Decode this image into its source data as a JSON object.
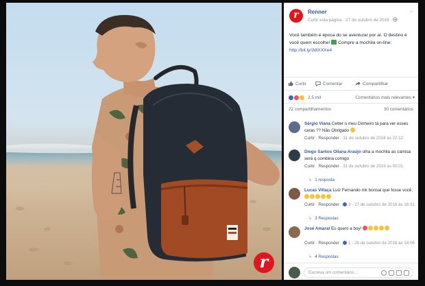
{
  "post": {
    "page_name": "Renner",
    "brand_initial": "r",
    "meta": "Curtir esta página · 27 de outubro de 2016 ·",
    "text_before_emoji": "Você também é época do se aventurar por aí. O destino é você quem escolhe!",
    "text_after_emoji": "Compre a mochila on-line:",
    "link": "http://bit.ly/2dlXXXe4"
  },
  "actions": {
    "like": "Curtir",
    "comment": "Comentar",
    "share": "Compartilhar"
  },
  "stats": {
    "reaction_count": "2,5 mil",
    "sort_label": "Comentários mais relevantes",
    "shares": "22 compartilhamentos",
    "comments_count": "30 comentários"
  },
  "comments": [
    {
      "author": "Sérgio Viana",
      "text": "Cetter o meu Dinheiro tá para ver esses caras ?? Não Obrigado",
      "like": "Curtir",
      "reply": "Responder",
      "time": "31 de outubro de 2016 às 22:12",
      "avatar_color": "#5b6d8a"
    },
    {
      "author": "Diego Santos Oliana Araújo",
      "text": "olha a mochila as camisa será q combina comigo",
      "like": "Curtir",
      "reply": "Responder",
      "time": "31 de outubro de 2016 às 00:01",
      "replies": "1 resposta",
      "avatar_color": "#2d3b4a"
    },
    {
      "author": "Lucas Villaça",
      "text": "Luiz Fernando mk bonsai que fosse você.",
      "like": "Curtir",
      "reply": "Responder",
      "reaction_count": "3",
      "time": "27 de outubro de 2016 às 16:31",
      "replies": "3 Respostas",
      "avatar_color": "#7c5a45"
    },
    {
      "author": "José Amaral",
      "text": "Eu quero a boy!",
      "like": "Curtir",
      "reply": "Responder",
      "reaction_count": "1",
      "time": "28 de outubro de 2016 às 14:06",
      "replies": "4 Respostas",
      "avatar_color": "#8a6a52"
    }
  ],
  "composer": {
    "placeholder": "Escreva um comentário..."
  },
  "colors": {
    "brand": "#e0161e",
    "link": "#365899",
    "like_blue": "#4267b2"
  }
}
